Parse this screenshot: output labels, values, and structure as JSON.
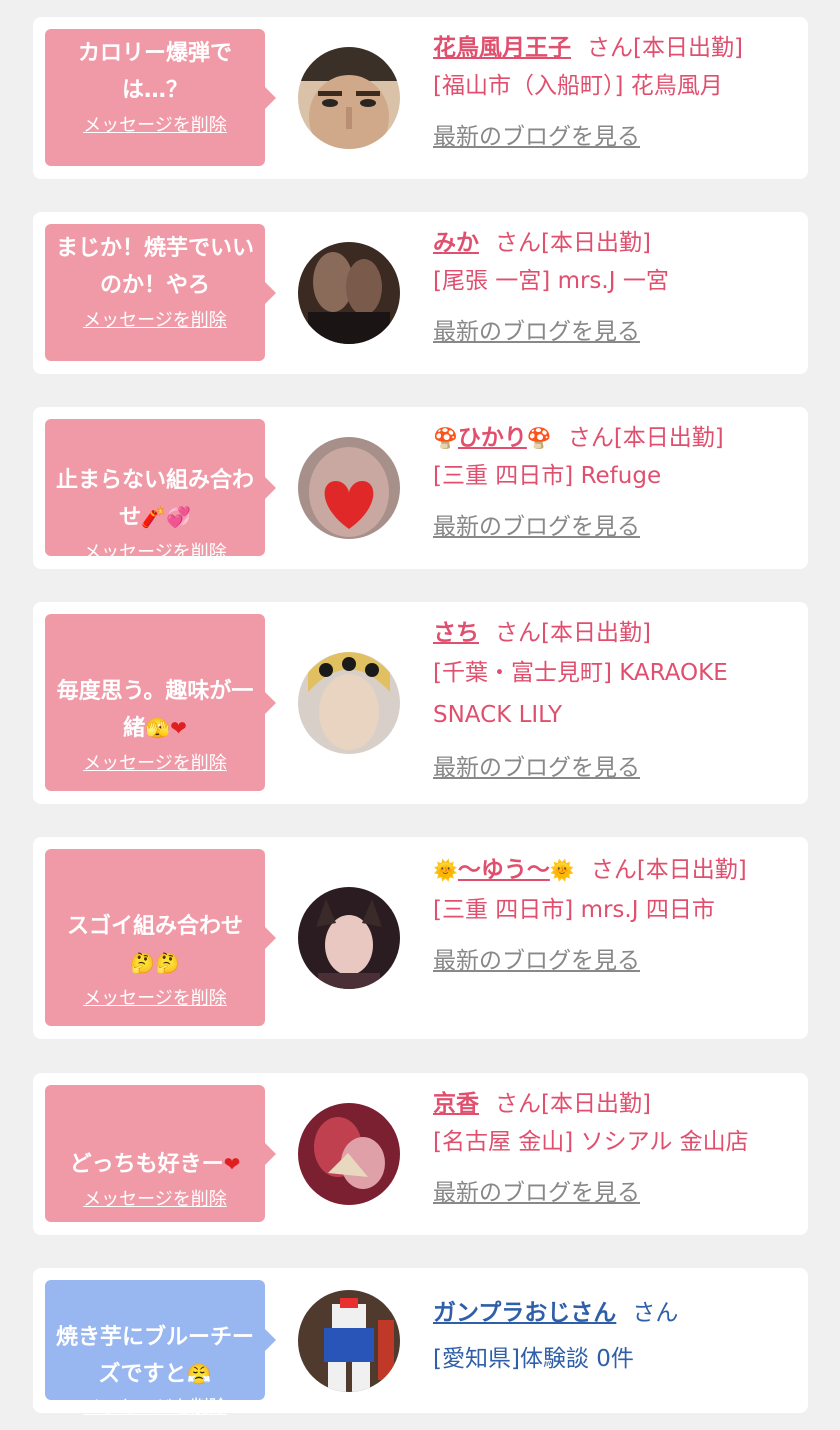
{
  "messages": [
    {
      "bubble": "カロリー爆弾では…？",
      "delete": "メッセージを削除",
      "name": "花鳥風月王子",
      "suffix": "さん[本日出勤]",
      "shop": "[福山市（入船町）] 花鳥風月",
      "blog": "最新のブログを見る"
    },
    {
      "bubble": "まじか！焼芋でいいのか！やろ",
      "delete": "メッセージを削除",
      "name": "みか",
      "suffix": "さん[本日出勤]",
      "shop": "[尾張 一宮] mrs.J 一宮",
      "blog": "最新のブログを見る"
    },
    {
      "bubble": "止まらない組み合わせ",
      "delete": "メッセージを削除",
      "name": "ひかり",
      "suffix": "さん[本日出勤]",
      "shop": "[三重 四日市] Refuge",
      "blog": "最新のブログを見る"
    },
    {
      "bubble": "毎度思う。趣味が一緒",
      "delete": "メッセージを削除",
      "name": "さち",
      "suffix": "さん[本日出勤]",
      "shop": "[千葉・富士見町] KARAOKE SNACK LILY",
      "blog": "最新のブログを見る"
    },
    {
      "bubble": "スゴイ組み合わせ",
      "delete": "メッセージを削除",
      "name": "〜ゆう〜",
      "suffix": "さん[本日出勤]",
      "shop": "[三重 四日市] mrs.J 四日市",
      "blog": "最新のブログを見る"
    },
    {
      "bubble": "どっちも好きー",
      "delete": "メッセージを削除",
      "name": "京香",
      "suffix": "さん[本日出勤]",
      "shop": "[名古屋 金山] ソシアル 金山店",
      "blog": "最新のブログを見る"
    },
    {
      "bubble": "焼き芋にブルーチーズですと",
      "delete": "メッセージを削除",
      "name": "ガンプラおじさん",
      "suffix": "さん",
      "shop": "[愛知県]体験談 0件"
    }
  ],
  "colors": {
    "pink_bubble": "#f09aa8",
    "blue_bubble": "#98b6f0",
    "name_pink": "#e0506e",
    "name_blue": "#2f5fa8",
    "blog_link": "#888888",
    "background": "#f0f0f0"
  }
}
